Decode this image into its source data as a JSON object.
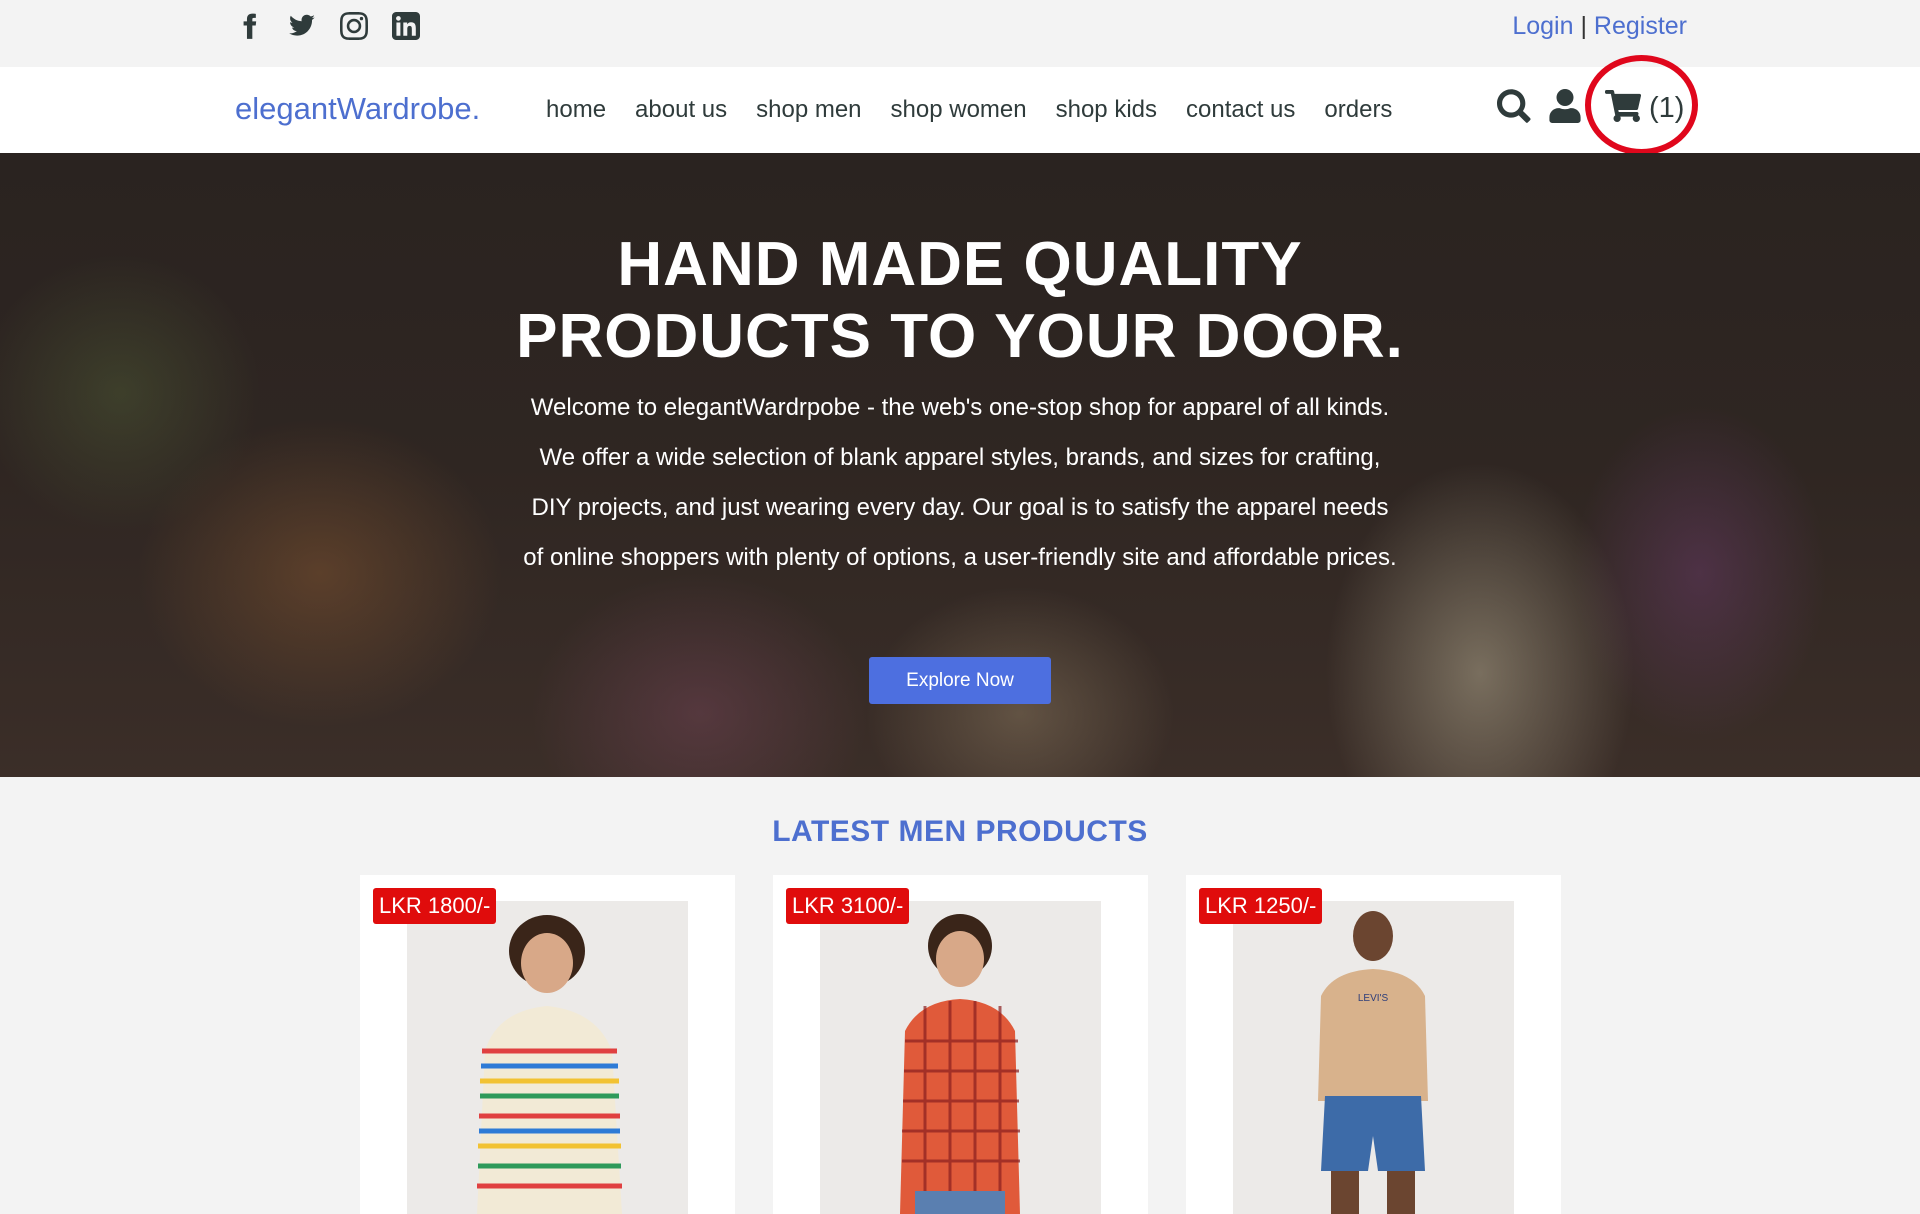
{
  "topbar": {
    "social": [
      "facebook-icon",
      "twitter-icon",
      "instagram-icon",
      "linkedin-icon"
    ],
    "login_label": "Login",
    "separator": "|",
    "register_label": "Register"
  },
  "navbar": {
    "logo": "elegantWardrobe.",
    "links": [
      "home",
      "about us",
      "shop men",
      "shop women",
      "shop kids",
      "contact us",
      "orders"
    ],
    "cart_count": "(1)"
  },
  "hero": {
    "title_line1": "HAND MADE QUALITY",
    "title_line2": "PRODUCTS TO YOUR DOOR.",
    "text": "Welcome to elegantWardrpobe - the web's one-stop shop for apparel of all kinds. We offer a wide selection of blank apparel styles, brands, and sizes for crafting, DIY projects, and just wearing every day. Our goal is to satisfy the apparel needs of online shoppers with plenty of options, a user-friendly site and affordable prices.",
    "button_label": "Explore Now"
  },
  "products": {
    "section_title": "LATEST MEN PRODUCTS",
    "items": [
      {
        "price": "LKR 1800/-"
      },
      {
        "price": "LKR 3100/-"
      },
      {
        "price": "LKR 1250/-"
      }
    ]
  },
  "colors": {
    "accent": "#4d6fcf",
    "button": "#4d6fe0",
    "price_badge": "#e00c0c",
    "annotation_circle": "#e0071c"
  }
}
